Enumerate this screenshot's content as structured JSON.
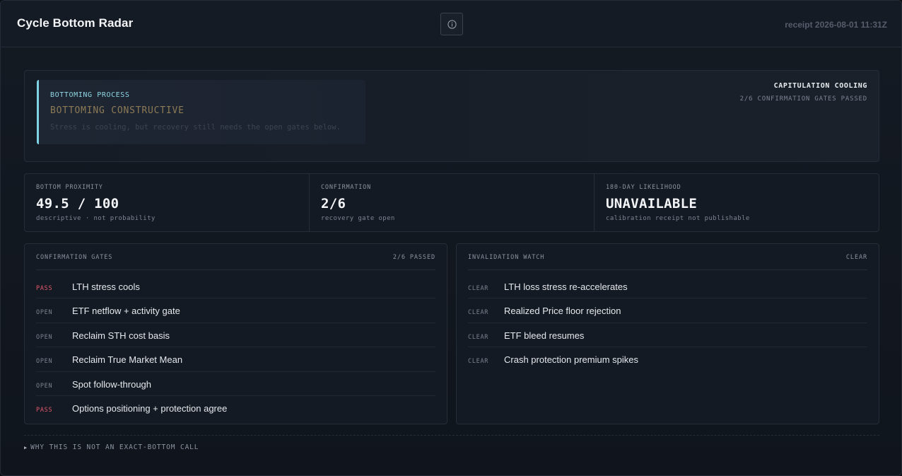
{
  "header": {
    "title": "Cycle Bottom Radar",
    "info_icon": "info-circle-icon",
    "receipt": "receipt 2026-08-01 11:31Z"
  },
  "regime": {
    "kicker": "BOTTOMING PROCESS",
    "title": "BOTTOMING CONSTRUCTIVE",
    "description": "Stress is cooling, but recovery still needs the open gates below.",
    "phase": "CAPITULATION COOLING",
    "gates_summary": "2/6 CONFIRMATION GATES PASSED",
    "accent_color": "#7fd3e4"
  },
  "metrics": [
    {
      "label": "BOTTOM PROXIMITY",
      "value": "49.5 / 100",
      "sub": "descriptive · not probability"
    },
    {
      "label": "CONFIRMATION",
      "value": "2/6",
      "sub": "recovery gate open"
    },
    {
      "label": "180-DAY LIKELIHOOD",
      "value": "UNAVAILABLE",
      "sub": "calibration receipt not publishable"
    }
  ],
  "confirmation": {
    "title": "CONFIRMATION GATES",
    "count": "2/6 PASSED",
    "rows": [
      {
        "status": "PASS",
        "label": "LTH stress cools"
      },
      {
        "status": "OPEN",
        "label": "ETF netflow + activity gate"
      },
      {
        "status": "OPEN",
        "label": "Reclaim STH cost basis"
      },
      {
        "status": "OPEN",
        "label": "Reclaim True Market Mean"
      },
      {
        "status": "OPEN",
        "label": "Spot follow-through"
      },
      {
        "status": "PASS",
        "label": "Options positioning + protection agree"
      }
    ]
  },
  "invalidation": {
    "title": "INVALIDATION WATCH",
    "count": "CLEAR",
    "rows": [
      {
        "status": "CLEAR",
        "label": "LTH loss stress re-accelerates"
      },
      {
        "status": "CLEAR",
        "label": "Realized Price floor rejection"
      },
      {
        "status": "CLEAR",
        "label": "ETF bleed resumes"
      },
      {
        "status": "CLEAR",
        "label": "Crash protection premium spikes"
      }
    ]
  },
  "footer": {
    "disclosure": "WHY THIS IS NOT AN EXACT-BOTTOM CALL",
    "caret_icon": "triangle-right-icon"
  },
  "colors": {
    "pass": "#e2586c",
    "background": "#0b0e13"
  }
}
